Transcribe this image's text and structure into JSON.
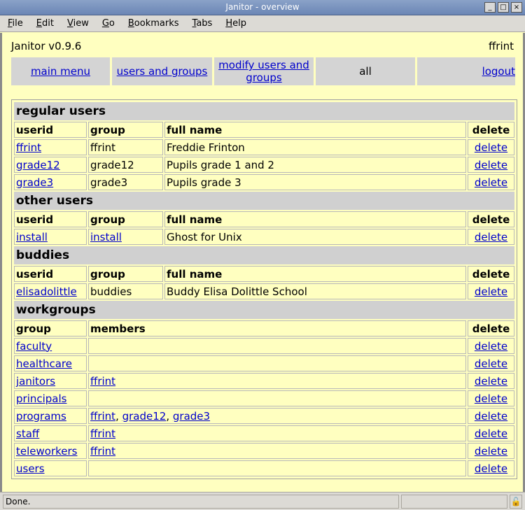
{
  "window": {
    "title": "Janitor - overview",
    "buttons": [
      "_",
      "□",
      "×"
    ]
  },
  "menu": [
    "File",
    "Edit",
    "View",
    "Go",
    "Bookmarks",
    "Tabs",
    "Help"
  ],
  "header": {
    "version": "Janitor v0.9.6",
    "user": "ffrint"
  },
  "nav": {
    "main_menu": "main menu",
    "users_and_groups": "users and groups",
    "modify_users_and_groups": "modify users and groups",
    "all": "all",
    "logout": "logout"
  },
  "regular_users": {
    "title": "regular users",
    "headers": [
      "userid",
      "group",
      "full name",
      "delete"
    ],
    "rows": [
      {
        "userid": "ffrint",
        "group": "ffrint",
        "full_name": "Freddie Frinton",
        "del": "delete"
      },
      {
        "userid": "grade12",
        "group": "grade12",
        "full_name": "Pupils grade 1 and 2",
        "del": "delete"
      },
      {
        "userid": "grade3",
        "group": "grade3",
        "full_name": "Pupils grade 3",
        "del": "delete"
      }
    ]
  },
  "other_users": {
    "title": "other users",
    "headers": [
      "userid",
      "group",
      "full name",
      "delete"
    ],
    "rows": [
      {
        "userid": "install",
        "group": "install",
        "full_name": "Ghost for Unix",
        "del": "delete"
      }
    ]
  },
  "buddies": {
    "title": "buddies",
    "headers": [
      "userid",
      "group",
      "full name",
      "delete"
    ],
    "rows": [
      {
        "userid": "elisadolittle",
        "group": "buddies",
        "full_name": "Buddy Elisa Dolittle School",
        "del": "delete"
      }
    ]
  },
  "workgroups": {
    "title": "workgroups",
    "headers": [
      "group",
      "members",
      "delete"
    ],
    "rows": [
      {
        "group": "faculty",
        "members": [],
        "del": "delete"
      },
      {
        "group": "healthcare",
        "members": [],
        "del": "delete"
      },
      {
        "group": "janitors",
        "members": [
          "ffrint"
        ],
        "del": "delete"
      },
      {
        "group": "principals",
        "members": [],
        "del": "delete"
      },
      {
        "group": "programs",
        "members": [
          "ffrint",
          "grade12",
          "grade3"
        ],
        "del": "delete"
      },
      {
        "group": "staff",
        "members": [
          "ffrint"
        ],
        "del": "delete"
      },
      {
        "group": "teleworkers",
        "members": [
          "ffrint"
        ],
        "del": "delete"
      },
      {
        "group": "users",
        "members": [],
        "del": "delete"
      }
    ]
  },
  "status": {
    "text": "Done.",
    "lock_icon": "🔓"
  }
}
